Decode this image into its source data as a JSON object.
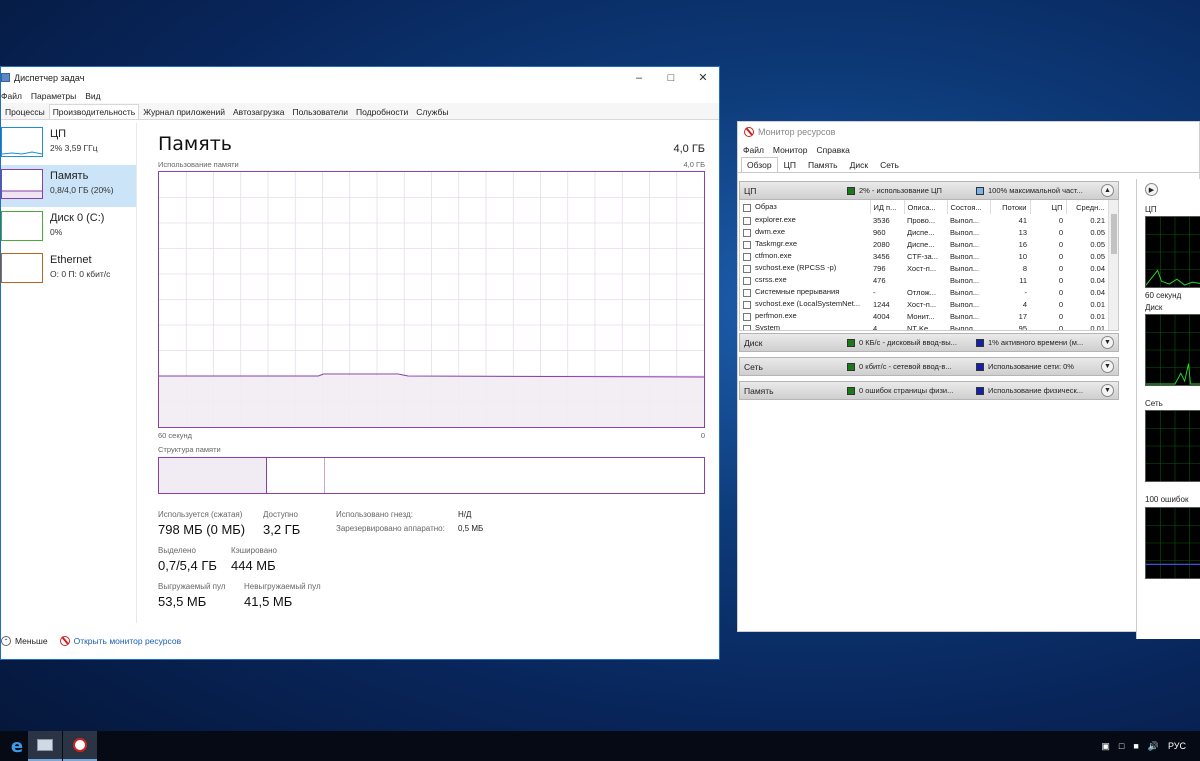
{
  "task_manager": {
    "title": "Диспетчер задач",
    "menu": [
      "Файл",
      "Параметры",
      "Вид"
    ],
    "tabs": [
      "Процессы",
      "Производительность",
      "Журнал приложений",
      "Автозагрузка",
      "Пользователи",
      "Подробности",
      "Службы"
    ],
    "active_tab": "Производительность",
    "sidebar": [
      {
        "name": "ЦП",
        "value": "2% 3,59 ГГц"
      },
      {
        "name": "Память",
        "value": "0,8/4,0 ГБ (20%)"
      },
      {
        "name": "Диск 0 (C:)",
        "value": "0%"
      },
      {
        "name": "Ethernet",
        "value": "О: 0 П: 0 кбит/с"
      }
    ],
    "main": {
      "title": "Память",
      "total": "4,0 ГБ",
      "usage_label": "Использование памяти",
      "usage_max": "4,0 ГБ",
      "time_left": "60 секунд",
      "time_right": "0",
      "usage_fraction": 0.2,
      "structure_label": "Структура памяти",
      "stats": {
        "used_label": "Используется (сжатая)",
        "used_value": "798 МБ (0 МБ)",
        "avail_label": "Доступно",
        "avail_value": "3,2 ГБ",
        "slots_label": "Использовано гнезд:",
        "slots_value": "Н/Д",
        "reserved_label": "Зарезервировано аппаратно:",
        "reserved_value": "0,5 МБ",
        "committed_label": "Выделено",
        "committed_value": "0,7/5,4 ГБ",
        "cached_label": "Кэшировано",
        "cached_value": "444 МБ",
        "paged_label": "Выгружаемый пул",
        "paged_value": "53,5 МБ",
        "nonpaged_label": "Невыгружаемый пул",
        "nonpaged_value": "41,5 МБ"
      }
    },
    "footer": {
      "less": "Меньше",
      "open_rm": "Открыть монитор ресурсов"
    }
  },
  "resource_monitor": {
    "title": "Монитор ресурсов",
    "menu": [
      "Файл",
      "Монитор",
      "Справка"
    ],
    "tabs": [
      "Обзор",
      "ЦП",
      "Память",
      "Диск",
      "Сеть"
    ],
    "sections": {
      "cpu": {
        "name": "ЦП",
        "m1": "2% - использование ЦП",
        "m2": "100% максимальной част..."
      },
      "disk": {
        "name": "Диск",
        "m1": "0 КБ/с - дисковый ввод-вы...",
        "m2": "1% активного времени (м..."
      },
      "net": {
        "name": "Сеть",
        "m1": "0 кбит/с - сетевой ввод-в...",
        "m2": "Использование сети: 0%"
      },
      "mem": {
        "name": "Память",
        "m1": "0 ошибок страницы физи...",
        "m2": "Использование физическ..."
      }
    },
    "cpu_columns": [
      "Образ",
      "ИД п...",
      "Описа...",
      "Состоя...",
      "Потоки",
      "ЦП",
      "Средн..."
    ],
    "cpu_rows": [
      [
        "explorer.exe",
        "3536",
        "Прово...",
        "Выпол...",
        "41",
        "0",
        "0.21"
      ],
      [
        "dwm.exe",
        "960",
        "Диспе...",
        "Выпол...",
        "13",
        "0",
        "0.05"
      ],
      [
        "Taskmgr.exe",
        "2080",
        "Диспе...",
        "Выпол...",
        "16",
        "0",
        "0.05"
      ],
      [
        "ctfmon.exe",
        "3456",
        "CTF-за...",
        "Выпол...",
        "10",
        "0",
        "0.05"
      ],
      [
        "svchost.exe (RPCSS -p)",
        "796",
        "Хост-п...",
        "Выпол...",
        "8",
        "0",
        "0.04"
      ],
      [
        "csrss.exe",
        "476",
        "",
        "Выпол...",
        "11",
        "0",
        "0.04"
      ],
      [
        "Системные прерывания",
        "-",
        "Отлож...",
        "Выпол...",
        "-",
        "0",
        "0.04"
      ],
      [
        "svchost.exe (LocalSystemNet...",
        "1244",
        "Хост-п...",
        "Выпол...",
        "4",
        "0",
        "0.01"
      ],
      [
        "perfmon.exe",
        "4004",
        "Монит...",
        "Выпол...",
        "17",
        "0",
        "0.01"
      ],
      [
        "System",
        "4",
        "NT Ke...",
        "Выпол...",
        "95",
        "0",
        "0.01"
      ]
    ],
    "right": {
      "cpu_label": "ЦП",
      "time_label": "60 секунд",
      "disk_label": "Диск",
      "net_label": "Сеть",
      "mem_label": "100 ошибок"
    }
  },
  "taskbar": {
    "lang": "РУС",
    "items": [
      "edge-icon",
      "task-manager-icon",
      "resource-monitor-icon"
    ]
  }
}
